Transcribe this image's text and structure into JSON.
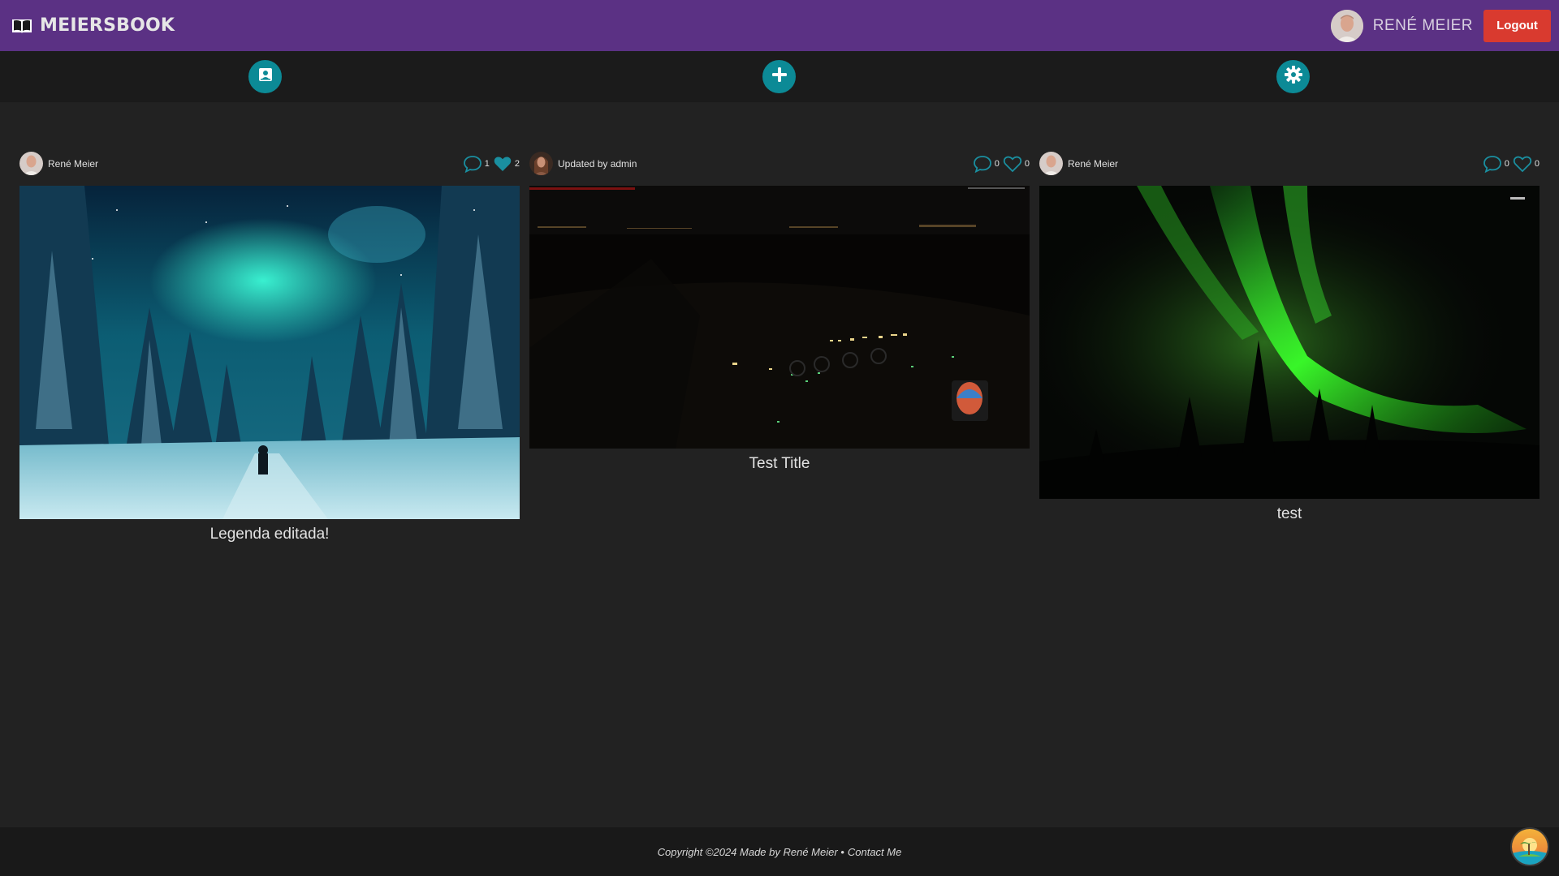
{
  "header": {
    "brand": "MEIERSBOOK",
    "user_name": "RENÉ MEIER",
    "logout_label": "Logout",
    "bg_color": "#5b3184",
    "logout_color": "#d93a2f"
  },
  "toolbar": {
    "buttons": [
      {
        "icon": "portrait-image-icon"
      },
      {
        "icon": "plus-icon"
      },
      {
        "icon": "gear-icon"
      }
    ],
    "accent": "#0c8a96"
  },
  "posts": [
    {
      "author": "René Meier",
      "comments": "1",
      "likes": "2",
      "liked": true,
      "caption": "Legenda editada!"
    },
    {
      "author": "Updated by admin",
      "comments": "0",
      "likes": "0",
      "liked": false,
      "caption": "Test Title"
    },
    {
      "author": "René Meier",
      "comments": "0",
      "likes": "0",
      "liked": false,
      "caption": "test"
    }
  ],
  "footer": {
    "copyright": "Copyright ©2024 Made by René Meier •",
    "contact": "Contact Me"
  }
}
